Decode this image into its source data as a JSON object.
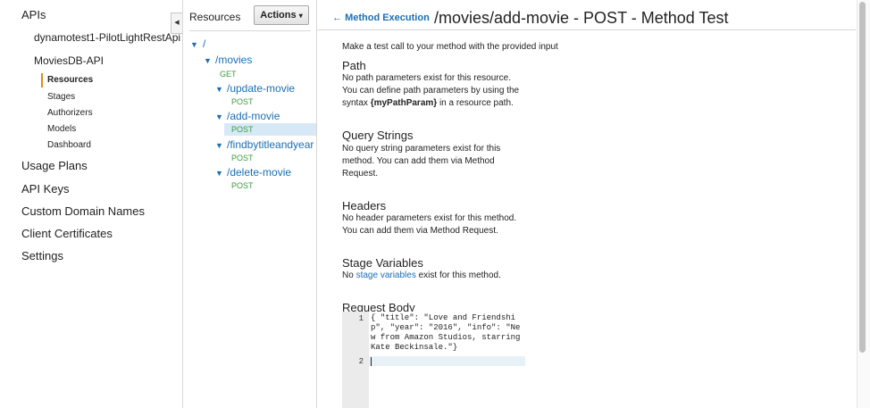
{
  "nav": {
    "apis_label": "APIs",
    "api_items": [
      "dynamotest1-PilotLightRestApi",
      "MoviesDB-API"
    ],
    "sub_items": [
      "Resources",
      "Stages",
      "Authorizers",
      "Models",
      "Dashboard"
    ],
    "top_items": [
      "Usage Plans",
      "API Keys",
      "Custom Domain Names",
      "Client Certificates",
      "Settings"
    ],
    "active_color": "#e5891d"
  },
  "resources": {
    "header": "Resources",
    "actions_label": "Actions",
    "tree": {
      "root": "/",
      "movies": "/movies",
      "movies_get": "GET",
      "update_movie": "/update-movie",
      "update_post": "POST",
      "add_movie": "/add-movie",
      "add_post": "POST",
      "findby": "/findbytitleandyear",
      "findby_post": "POST",
      "delete_movie": "/delete-movie",
      "delete_post": "POST"
    }
  },
  "main": {
    "back_link": "Method Execution",
    "title": "/movies/add-movie - POST - Method Test",
    "intro": "Make a test call to your method with the provided input",
    "path": {
      "title": "Path",
      "line1": "No path parameters exist for this resource.",
      "line2": "You can define path parameters by using the",
      "line3_pre": "syntax",
      "line3_bold": "{myPathParam}",
      "line3_post": "in a resource path."
    },
    "query": {
      "title": "Query Strings",
      "line1": "No query string parameters exist for this",
      "line2": "method. You can add them via Method",
      "line3": "Request."
    },
    "headers": {
      "title": "Headers",
      "line1": "No header parameters exist for this method.",
      "line2": "You can add them via Method Request."
    },
    "stage": {
      "title": "Stage Variables",
      "pre": "No",
      "link": "stage variables",
      "post": "exist for this method."
    },
    "body": {
      "title": "Request Body",
      "line_numbers": [
        "1",
        "2"
      ],
      "code_line1": "{ \"title\": \"Love and Friendship\", \"year\": \"2016\", \"info\": \"New from Amazon Studios, starring Kate Beckinsale.\"}",
      "code_line2": ""
    }
  },
  "colors": {
    "link": "#1a6fb3",
    "method": "#3c9a3c",
    "selected_row": "#d7e9f7"
  }
}
